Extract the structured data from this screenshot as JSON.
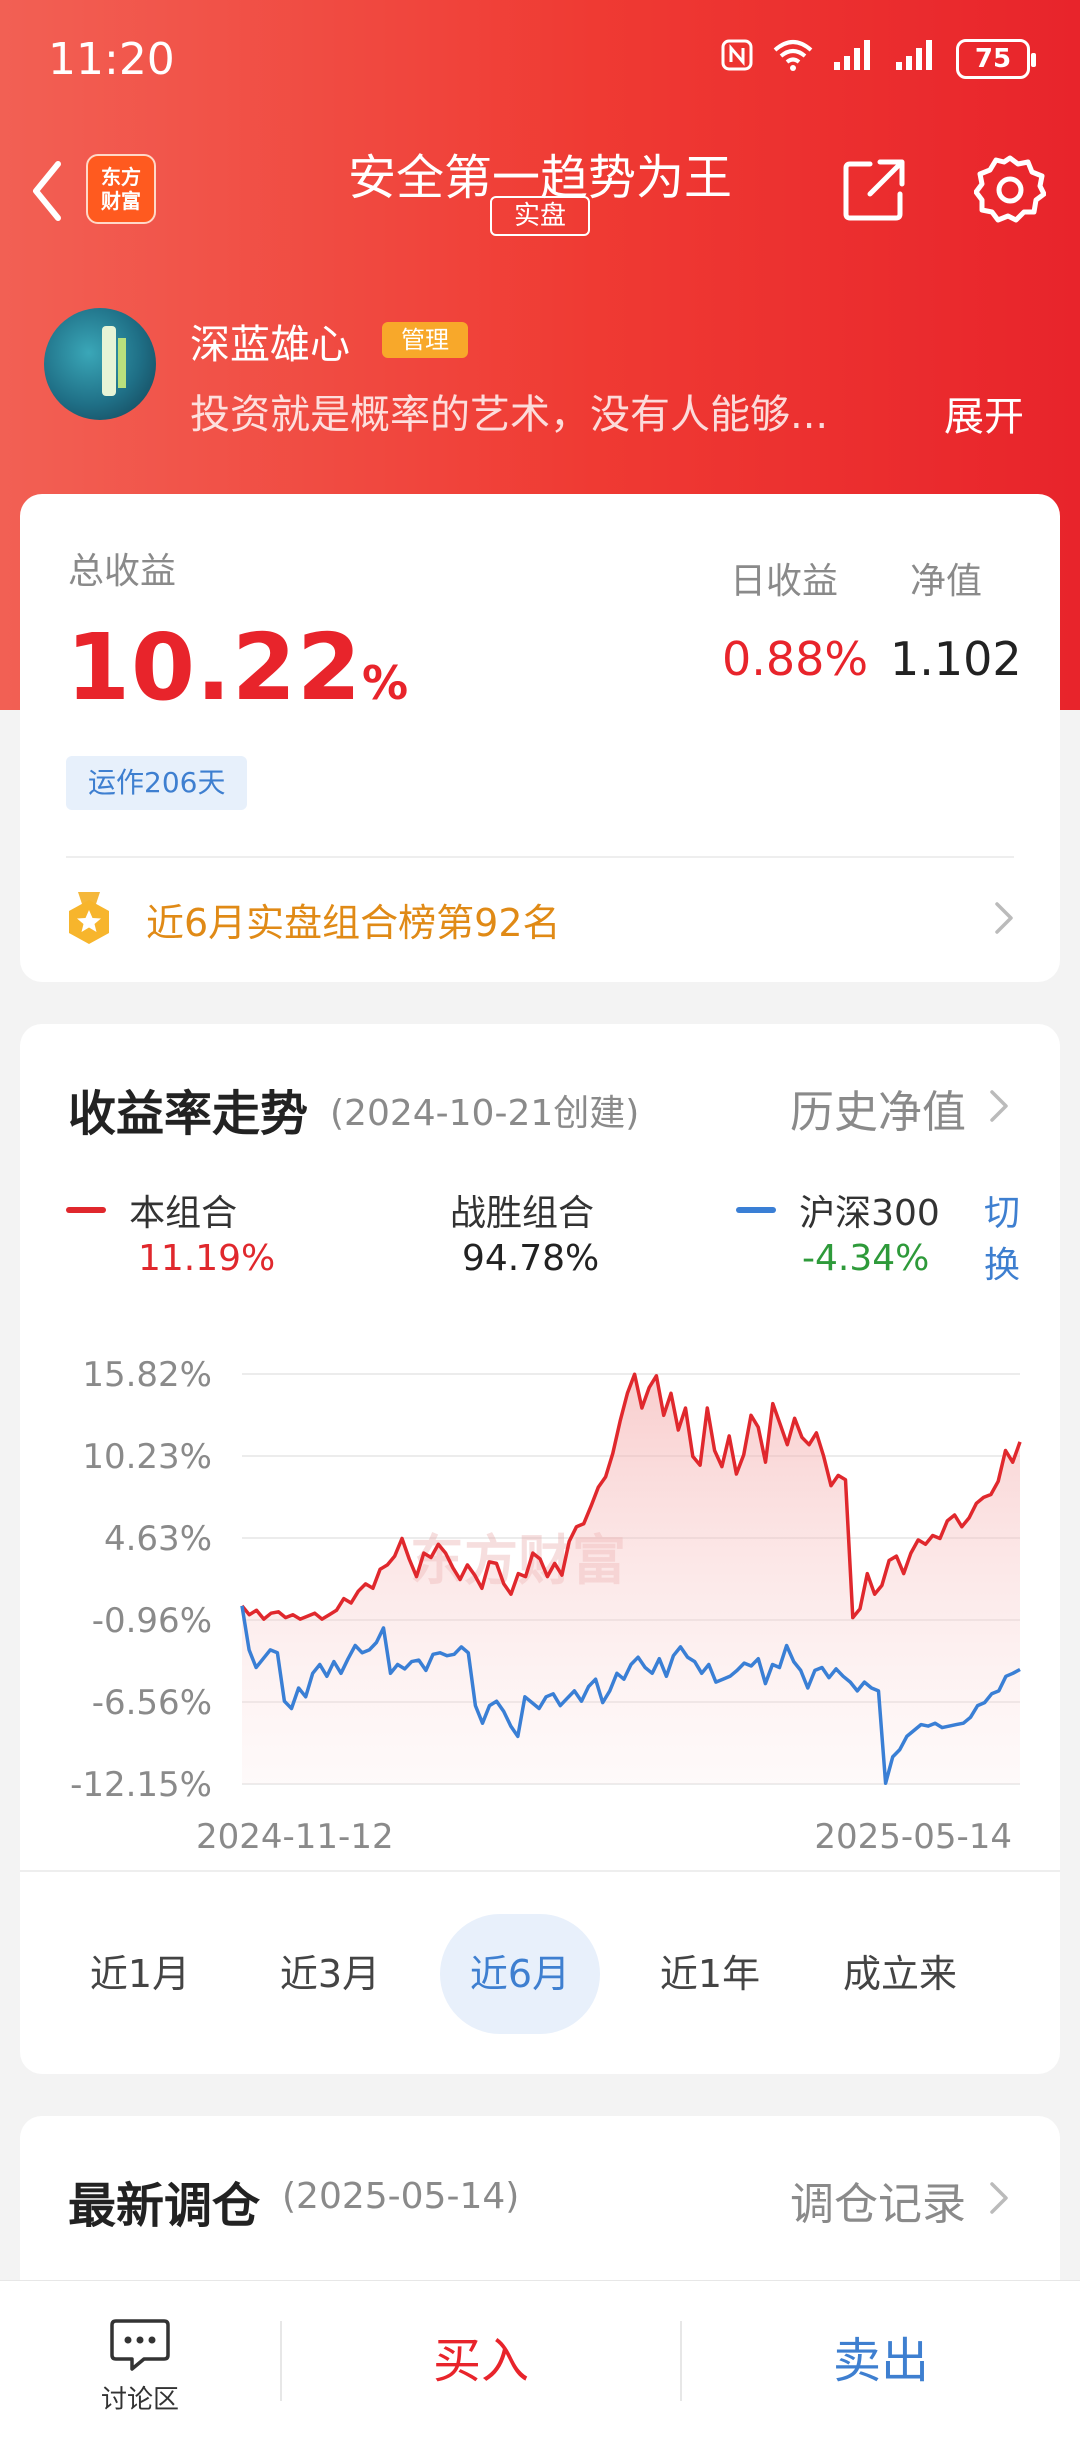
{
  "status_bar": {
    "time": "11:20",
    "battery": "75"
  },
  "nav": {
    "logo_line1": "东方",
    "logo_line2": "财富",
    "title": "安全第一趋势为王",
    "tag": "实盘"
  },
  "profile": {
    "name": "深蓝雄心",
    "badge": "管理",
    "bio": "投资就是概率的艺术，没有人能够...",
    "expand": "展开"
  },
  "summary": {
    "total_label": "总收益",
    "total_value": "10.22",
    "total_unit": "%",
    "day_label": "日收益",
    "day_value": "0.88%",
    "nav_label": "净值",
    "nav_value": "1.102",
    "days_running": "运作206天",
    "rank_text": "近6月实盘组合榜第92名"
  },
  "chart_section": {
    "title": "收益率走势",
    "created": "(2024-10-21创建)",
    "history_link": "历史净值",
    "switch": "切换",
    "legend": [
      {
        "name": "本组合",
        "value": "11.19%",
        "color": "#e0282d"
      },
      {
        "name": "战胜组合",
        "value": "94.78%",
        "color": "#222222"
      },
      {
        "name": "沪深300",
        "value": "-4.34%",
        "color": "#2e9a3a"
      }
    ],
    "watermark": "东方财富"
  },
  "chart_data": {
    "type": "line",
    "x_start": "2024-11-12",
    "x_end": "2025-05-14",
    "yticks": [
      "15.82%",
      "10.23%",
      "4.63%",
      "-0.96%",
      "-6.56%",
      "-12.15%"
    ],
    "ylim": [
      -12.15,
      15.82
    ],
    "series": [
      {
        "name": "本组合",
        "color": "#e0282d",
        "values": [
          0,
          -0.6,
          -0.3,
          -0.9,
          -0.5,
          -0.4,
          -0.8,
          -0.6,
          -0.9,
          -0.7,
          -0.5,
          -0.9,
          -0.6,
          -0.3,
          0.5,
          0.2,
          1.0,
          1.5,
          1.2,
          2.5,
          2.8,
          3.4,
          4.6,
          3.2,
          2.0,
          3.6,
          3.3,
          4.2,
          3.6,
          2.6,
          1.8,
          2.8,
          2.1,
          1.2,
          3.0,
          2.9,
          1.5,
          0.8,
          2.2,
          2.0,
          3.6,
          3.2,
          2.0,
          2.9,
          2.1,
          4.4,
          5.4,
          5.6,
          6.8,
          8.1,
          8.8,
          10.4,
          12.6,
          14.5,
          15.8,
          13.5,
          14.9,
          15.7,
          13.0,
          14.5,
          12.0,
          13.5,
          10.2,
          9.6,
          13.5,
          10.6,
          9.5,
          11.6,
          9.0,
          10.3,
          13.0,
          12.2,
          9.8,
          13.8,
          12.4,
          11.0,
          12.8,
          11.5,
          11.0,
          11.8,
          10.2,
          8.2,
          8.9,
          8.6,
          -0.8,
          -0.2,
          2.2,
          0.8,
          1.4,
          3.1,
          3.4,
          2.2,
          3.6,
          4.5,
          4.2,
          4.8,
          4.6,
          5.8,
          6.2,
          5.4,
          6.0,
          7.0,
          7.4,
          7.6,
          8.5,
          10.6,
          9.8,
          11.19
        ]
      },
      {
        "name": "沪深300",
        "color": "#3a7fd5",
        "values": [
          0,
          -3.0,
          -4.2,
          -3.6,
          -3.0,
          -3.2,
          -6.5,
          -7.0,
          -5.6,
          -6.2,
          -4.6,
          -4.0,
          -4.8,
          -3.8,
          -4.6,
          -3.6,
          -2.7,
          -3.2,
          -3.0,
          -2.5,
          -1.5,
          -4.6,
          -4.0,
          -4.3,
          -3.8,
          -3.7,
          -4.4,
          -3.3,
          -3.2,
          -3.4,
          -3.3,
          -2.8,
          -3.2,
          -6.8,
          -8.0,
          -6.8,
          -6.5,
          -7.2,
          -8.2,
          -8.9,
          -6.2,
          -6.6,
          -7.0,
          -6.2,
          -6.0,
          -6.8,
          -6.3,
          -5.8,
          -6.5,
          -5.5,
          -5.0,
          -6.6,
          -5.8,
          -4.6,
          -5.0,
          -4.0,
          -3.5,
          -4.2,
          -4.6,
          -3.6,
          -4.8,
          -3.4,
          -2.8,
          -3.5,
          -3.8,
          -4.6,
          -4.0,
          -5.2,
          -5.0,
          -4.8,
          -4.4,
          -3.9,
          -4.1,
          -3.6,
          -5.3,
          -4.0,
          -4.2,
          -2.7,
          -3.8,
          -4.4,
          -5.6,
          -4.4,
          -4.2,
          -4.9,
          -4.3,
          -4.8,
          -5.2,
          -5.8,
          -5.2,
          -5.6,
          -5.8,
          -12.1,
          -10.3,
          -9.8,
          -8.9,
          -8.5,
          -8.1,
          -8.2,
          -8.0,
          -8.3,
          -8.2,
          -8.1,
          -8.0,
          -7.6,
          -6.8,
          -6.6,
          -6.0,
          -5.8,
          -4.8,
          -4.6,
          -4.34
        ]
      }
    ]
  },
  "ranges": {
    "items": [
      "近1月",
      "近3月",
      "近6月",
      "近1年",
      "成立来"
    ],
    "active_index": 2
  },
  "rebalance": {
    "title": "最新调仓",
    "date": "(2025-05-14)",
    "link": "调仓记录"
  },
  "bottom_bar": {
    "discuss": "讨论区",
    "buy": "买入",
    "sell": "卖出"
  }
}
